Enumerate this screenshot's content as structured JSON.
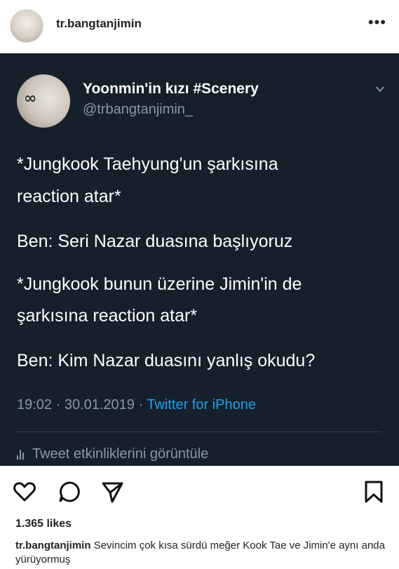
{
  "instagram": {
    "username": "tr.bangtanjimin",
    "more_icon": "more-dots-icon",
    "likes": "1.365 likes",
    "caption_user": "tr.bangtanjimin",
    "caption_text": "Sevincim çok kısa sürdü meğer Kook Tae ve Jimin'e aynı anda yürüyormuş",
    "actions": [
      "heart-icon",
      "comment-icon",
      "share-icon",
      "bookmark-icon"
    ]
  },
  "tweet": {
    "display_name": "Yoonmin'in kızı #Scenery",
    "handle": "@trbangtanjimin_",
    "lines": [
      "*Jungkook Taehyung'un şarkısına",
      "reaction atar*",
      "Ben: Seri Nazar duasına başlıyoruz",
      "*Jungkook bunun üzerine Jimin'in de",
      "şarkısına reaction atar*",
      "Ben: Kim Nazar duasını yanlış okudu?"
    ],
    "time": "19:02 · 30.01.2019 · ",
    "source": "Twitter for iPhone",
    "activity": "Tweet etkinliklerini görüntüle",
    "colors": {
      "background": "#15202b",
      "accent": "#1da1f2",
      "muted": "#8899a6"
    }
  }
}
